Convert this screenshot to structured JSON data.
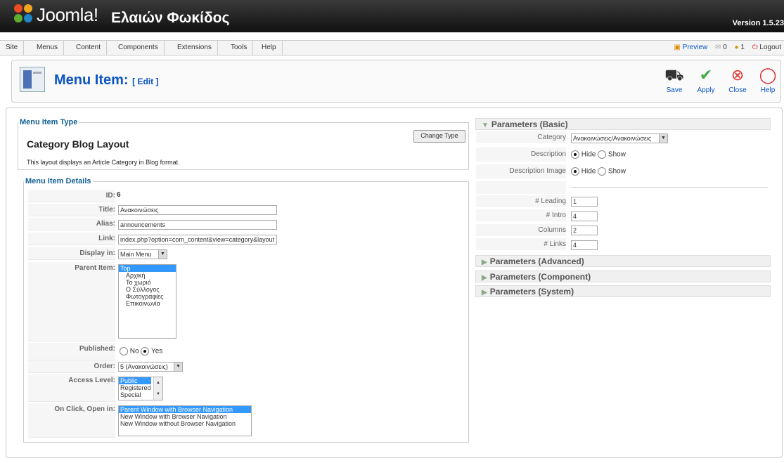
{
  "header": {
    "brand": "Joomla!",
    "site_name": "Ελαιών Φωκίδος",
    "version": "Version 1.5.23"
  },
  "menubar": {
    "items": [
      "Site",
      "Menus",
      "Content",
      "Components",
      "Extensions",
      "Tools",
      "Help"
    ],
    "preview": "Preview",
    "messages_count": "0",
    "users_count": "1",
    "logout": "Logout"
  },
  "toolbar": {
    "title": "Menu Item:",
    "title_suffix": "[ Edit ]",
    "save": "Save",
    "apply": "Apply",
    "close": "Close",
    "help": "Help"
  },
  "menu_item_type": {
    "legend": "Menu Item Type",
    "change_type": "Change Type",
    "layout_name": "Category Blog Layout",
    "layout_desc": "This layout displays an Article Category in Blog format."
  },
  "details": {
    "legend": "Menu Item Details",
    "id_label": "ID:",
    "id_value": "6",
    "title_label": "Title:",
    "title_value": "Ανακοινώσεις",
    "alias_label": "Alias:",
    "alias_value": "announcements",
    "link_label": "Link:",
    "link_value": "index.php?option=com_content&view=category&layout",
    "display_label": "Display in:",
    "display_value": "Main Menu",
    "parent_label": "Parent Item:",
    "parent_options": [
      "Top",
      "Αρχική",
      "Το χωριό",
      "Ο Σύλλογος",
      "Φωτογραφίες",
      "Επικοινωνία"
    ],
    "published_label": "Published:",
    "published_no": "No",
    "published_yes": "Yes",
    "order_label": "Order:",
    "order_value": "5 (Ανακοινώσεις)",
    "access_label": "Access Level:",
    "access_options": [
      "Public",
      "Registered",
      "Special"
    ],
    "onclick_label": "On Click, Open in:",
    "onclick_options": [
      "Parent Window with Browser Navigation",
      "New Window with Browser Navigation",
      "New Window without Browser Navigation"
    ]
  },
  "params": {
    "basic": "Parameters (Basic)",
    "category_label": "Category",
    "category_value": "Ανακοινώσεις/Ανακοινώσεις",
    "description_label": "Description",
    "description_image_label": "Description Image",
    "hide": "Hide",
    "show": "Show",
    "leading_label": "# Leading",
    "leading_value": "1",
    "intro_label": "# Intro",
    "intro_value": "4",
    "columns_label": "Columns",
    "columns_value": "2",
    "links_label": "# Links",
    "links_value": "4",
    "advanced": "Parameters (Advanced)",
    "component": "Parameters (Component)",
    "system": "Parameters (System)"
  }
}
